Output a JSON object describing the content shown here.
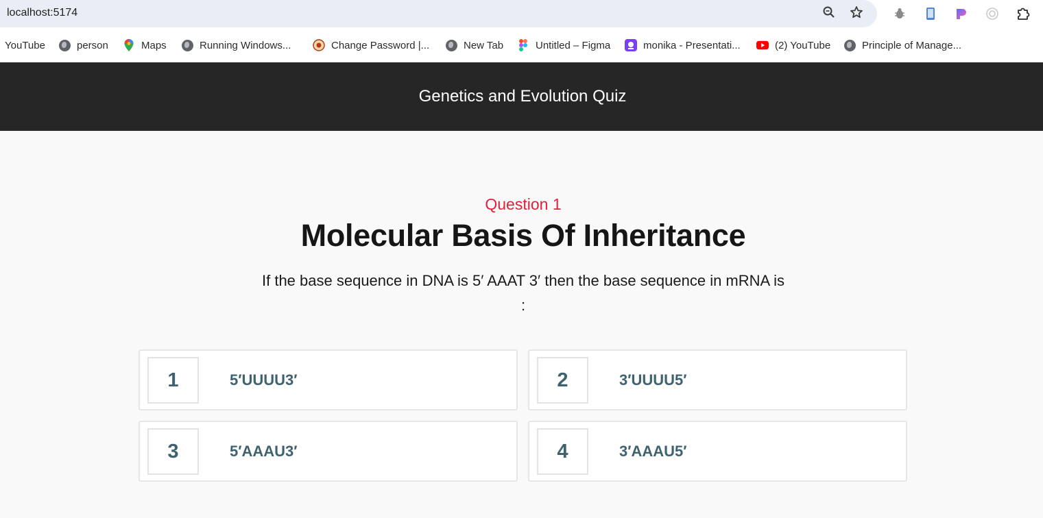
{
  "browser": {
    "url": "localhost:5174",
    "omnibox_icons": [
      "zoom-icon",
      "star-icon"
    ],
    "extensions": [
      "bug-extension-icon",
      "phone-extension-icon",
      "gradient-extension-icon",
      "target-extension-icon",
      "puzzle-extension-icon"
    ]
  },
  "bookmarks": [
    {
      "label": "YouTube",
      "icon": "none"
    },
    {
      "label": "person",
      "icon": "globe-icon"
    },
    {
      "label": "Maps",
      "icon": "maps-pin-icon"
    },
    {
      "label": "Running Windows...",
      "icon": "globe-icon"
    },
    {
      "label": "Change Password |...",
      "icon": "emblem-icon"
    },
    {
      "label": "New Tab",
      "icon": "globe-icon"
    },
    {
      "label": "Untitled – Figma",
      "icon": "figma-icon"
    },
    {
      "label": "monika - Presentati...",
      "icon": "presentation-icon"
    },
    {
      "label": "(2) YouTube",
      "icon": "youtube-icon"
    },
    {
      "label": "Principle of Manage...",
      "icon": "globe-icon"
    }
  ],
  "app": {
    "title": "Genetics and Evolution Quiz"
  },
  "question": {
    "number_label": "Question 1",
    "topic": "Molecular Basis Of Inheritance",
    "text": "If the base sequence in DNA is 5′ AAAT 3′ then the base sequence in mRNA is :"
  },
  "options": [
    {
      "num": "1",
      "text": "5′UUUU3′"
    },
    {
      "num": "2",
      "text": "3′UUUU5′"
    },
    {
      "num": "3",
      "text": "5′AAAU3′"
    },
    {
      "num": "4",
      "text": "3′AAAU5′"
    }
  ],
  "colors": {
    "header_bg": "#262626",
    "question_number": "#e0213a",
    "option_text": "#3f6270",
    "page_bg": "#f9f9f9"
  }
}
